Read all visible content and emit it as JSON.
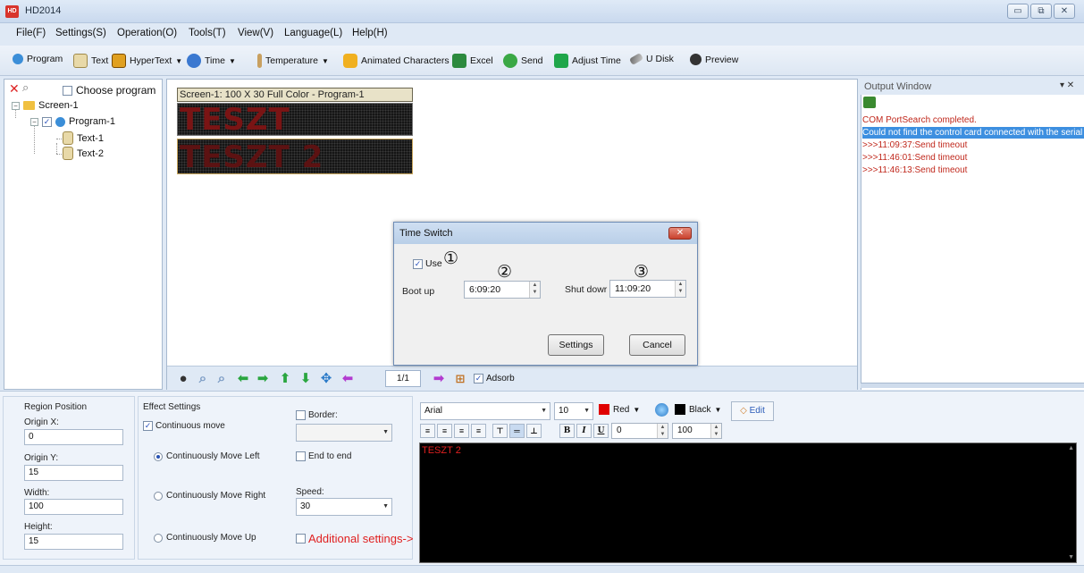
{
  "window": {
    "title": "HD2014",
    "app_icon": "HD",
    "controls": [
      "minimize-icon",
      "restore-icon",
      "close-icon"
    ]
  },
  "menu": [
    "File(F)",
    "Settings(S)",
    "Operation(O)",
    "Tools(T)",
    "View(V)",
    "Language(L)",
    "Help(H)"
  ],
  "toolbar": {
    "program": "Program",
    "text": "Text",
    "hypertext": "HyperText",
    "time": "Time",
    "temperature": "Temperature",
    "animated": "Animated Characters",
    "excel": "Excel",
    "send": "Send",
    "adjust_time": "Adjust Time",
    "udisk": "U Disk",
    "preview": "Preview"
  },
  "tree": {
    "choose_program": "Choose program",
    "screen": "Screen-1",
    "program": "Program-1",
    "text1": "Text-1",
    "text2": "Text-2"
  },
  "canvas": {
    "screen_label": "Screen-1: 100 X 30 Full Color - Program-1",
    "led1": "TESZT",
    "led2": "TESZT 2",
    "page": "1/1",
    "adsorb": "Adsorb"
  },
  "output": {
    "title": "Output Window",
    "lines": [
      "COM PortSearch completed.",
      "Could not find the control card connected with the serial p",
      ">>>11:09:37:Send timeout",
      ">>>11:46:01:Send timeout",
      ">>>11:46:13:Send timeout"
    ]
  },
  "dialog": {
    "title": "Time Switch",
    "use": "Use",
    "boot_label": "Boot up",
    "boot_value": "6:09:20",
    "shut_label": "Shut dowr",
    "shut_value": "11:09:20",
    "settings": "Settings",
    "cancel": "Cancel",
    "markers": [
      "①",
      "②",
      "③"
    ]
  },
  "region": {
    "title": "Region Position",
    "origin_x_label": "Origin X:",
    "origin_x": "0",
    "origin_y_label": "Origin Y:",
    "origin_y": "15",
    "width_label": "Width:",
    "width": "100",
    "height_label": "Height:",
    "height": "15"
  },
  "effect": {
    "title": "Effect Settings",
    "continuous": "Continuous move",
    "left": "Continuously Move Left",
    "right": "Continuously Move Right",
    "up": "Continuously Move Up",
    "border": "Border:",
    "end_to_end": "End to end",
    "speed_label": "Speed:",
    "speed": "30",
    "additional": "Additional settings->"
  },
  "format": {
    "font": "Arial",
    "size": "10",
    "color": "Red",
    "bg": "Black",
    "edit": "Edit",
    "spacing": "0",
    "scale": "100",
    "red": "#e00000",
    "black": "#000000"
  },
  "editor_text": "TESZT 2"
}
